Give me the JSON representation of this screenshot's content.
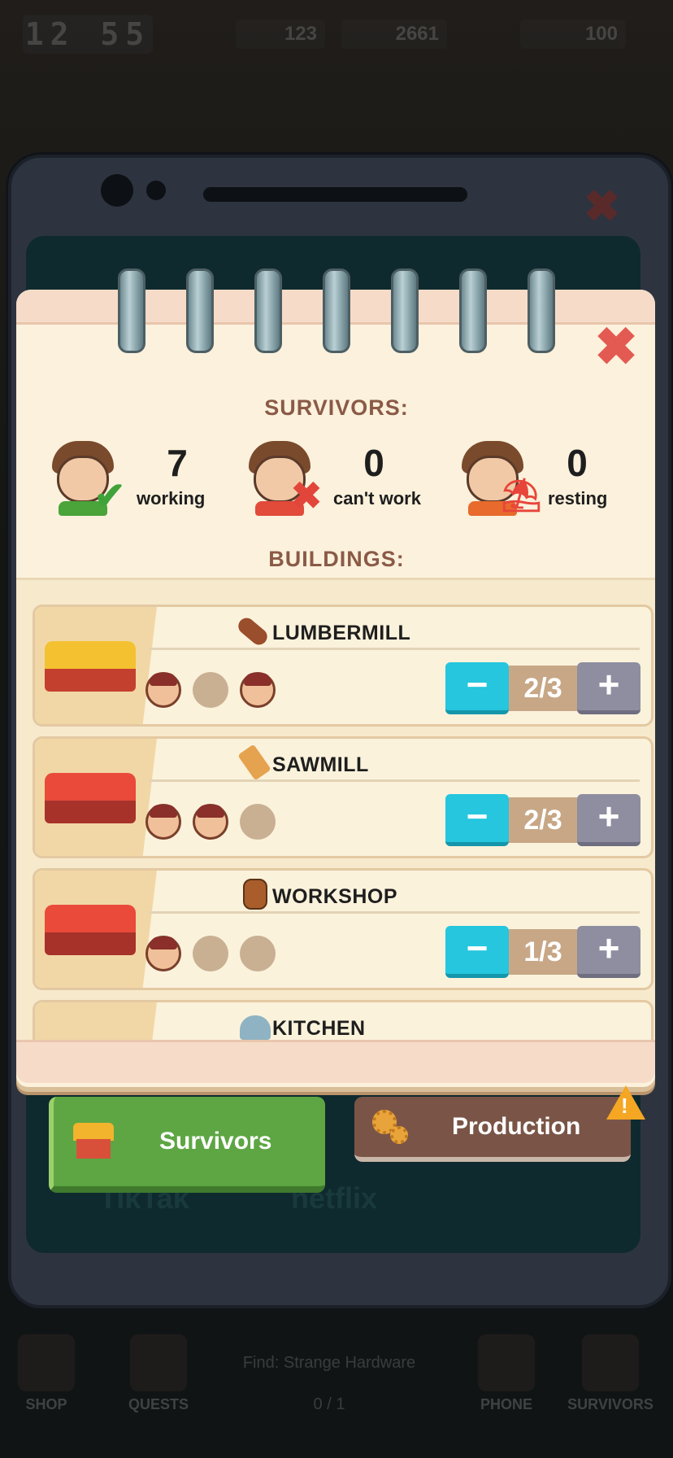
{
  "hud": {
    "clock": "12:55",
    "resources": [
      "123",
      "2661",
      "100"
    ],
    "markers": [
      "20",
      "18"
    ]
  },
  "background_nav": {
    "items": [
      "SHOP",
      "QUESTS",
      "PHONE",
      "SURVIVORS"
    ],
    "quest_text": "Find: Strange Hardware",
    "quest_progress": "0 / 1"
  },
  "phone_screen": {
    "apps": [
      "TikTak",
      "netflix"
    ]
  },
  "survivors": {
    "title": "SURVIVORS:",
    "stats": [
      {
        "count": "7",
        "label": "working",
        "badge": "check-icon"
      },
      {
        "count": "0",
        "label": "can't work",
        "badge": "cross-icon"
      },
      {
        "count": "0",
        "label": "resting",
        "badge": "beach-chair-icon"
      }
    ]
  },
  "buildings": {
    "title": "BUILDINGS:",
    "items": [
      {
        "name": "LUMBERMILL",
        "icon": "log-icon",
        "assigned": "2/3",
        "slots": [
          "filled",
          "empty",
          "filled"
        ]
      },
      {
        "name": "SAWMILL",
        "icon": "plank-icon",
        "assigned": "2/3",
        "slots": [
          "filled",
          "filled",
          "empty"
        ]
      },
      {
        "name": "WORKSHOP",
        "icon": "barrel-icon",
        "assigned": "1/3",
        "slots": [
          "filled",
          "empty",
          "empty"
        ]
      },
      {
        "name": "KITCHEN",
        "icon": "cloche-icon"
      }
    ]
  },
  "tabs": {
    "survivors": "Survivors",
    "production": "Production"
  },
  "colors": {
    "accent_minus": "#25c6de",
    "accent_plus": "#8e8ea0",
    "tab_active": "#5da643",
    "tab_inactive": "#7a5547",
    "title_brown": "#8a5a47",
    "close_red": "#e35a52"
  }
}
